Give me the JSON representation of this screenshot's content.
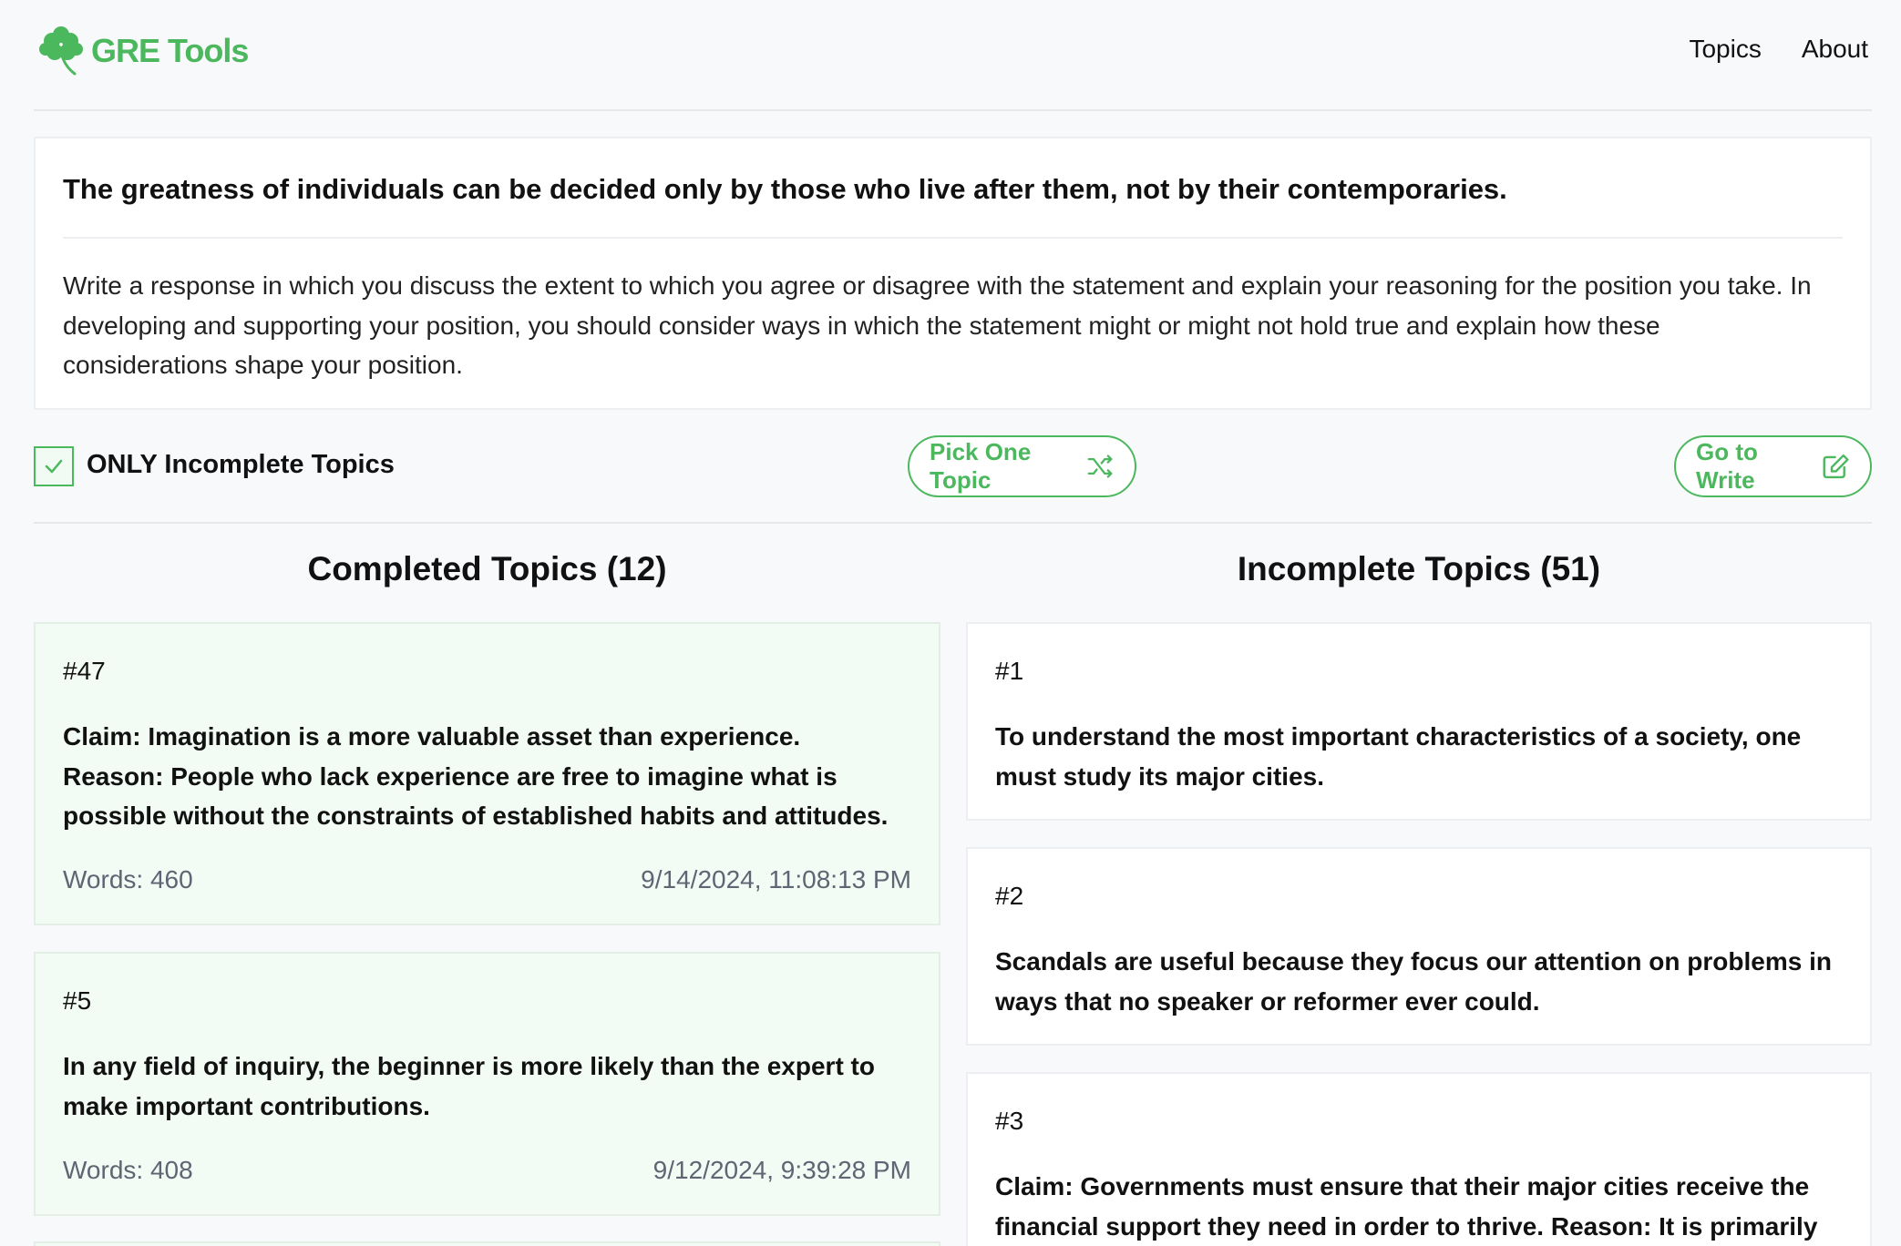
{
  "header": {
    "logo_text": "GRE Tools",
    "nav": [
      "Topics",
      "About"
    ]
  },
  "prompt": {
    "title": "The greatness of individuals can be decided only by those who live after them, not by their contemporaries.",
    "instruction": "Write a response in which you discuss the extent to which you agree or disagree with the statement and explain your reasoning for the position you take. In developing and supporting your position, you should consider ways in which the statement might or might not hold true and explain how these considerations shape your position."
  },
  "controls": {
    "checkbox_label": "ONLY Incomplete Topics",
    "checkbox_checked": true,
    "pick_label": "Pick One Topic",
    "write_label": "Go to Write"
  },
  "completed": {
    "heading": "Completed Topics (12)",
    "items": [
      {
        "num": "#47",
        "text": "Claim: Imagination is a more valuable asset than experience. Reason: People who lack experience are free to imagine what is possible without the constraints of established habits and attitudes.",
        "words": "Words: 460",
        "date": "9/14/2024, 11:08:13 PM"
      },
      {
        "num": "#5",
        "text": "In any field of inquiry, the beginner is more likely than the expert to make important contributions.",
        "words": "Words: 408",
        "date": "9/12/2024, 9:39:28 PM"
      }
    ]
  },
  "incomplete": {
    "heading": "Incomplete Topics (51)",
    "items": [
      {
        "num": "#1",
        "text": "To understand the most important characteristics of a society, one must study its major cities."
      },
      {
        "num": "#2",
        "text": "Scandals are useful because they focus our attention on problems in ways that no speaker or reformer ever could."
      },
      {
        "num": "#3",
        "text": "Claim: Governments must ensure that their major cities receive the financial support they need in order to thrive. Reason: It is primarily in"
      }
    ]
  },
  "colors": {
    "accent": "#4cb85e",
    "completed_bg": "#f2fbf4",
    "muted_text": "#5d6673"
  }
}
